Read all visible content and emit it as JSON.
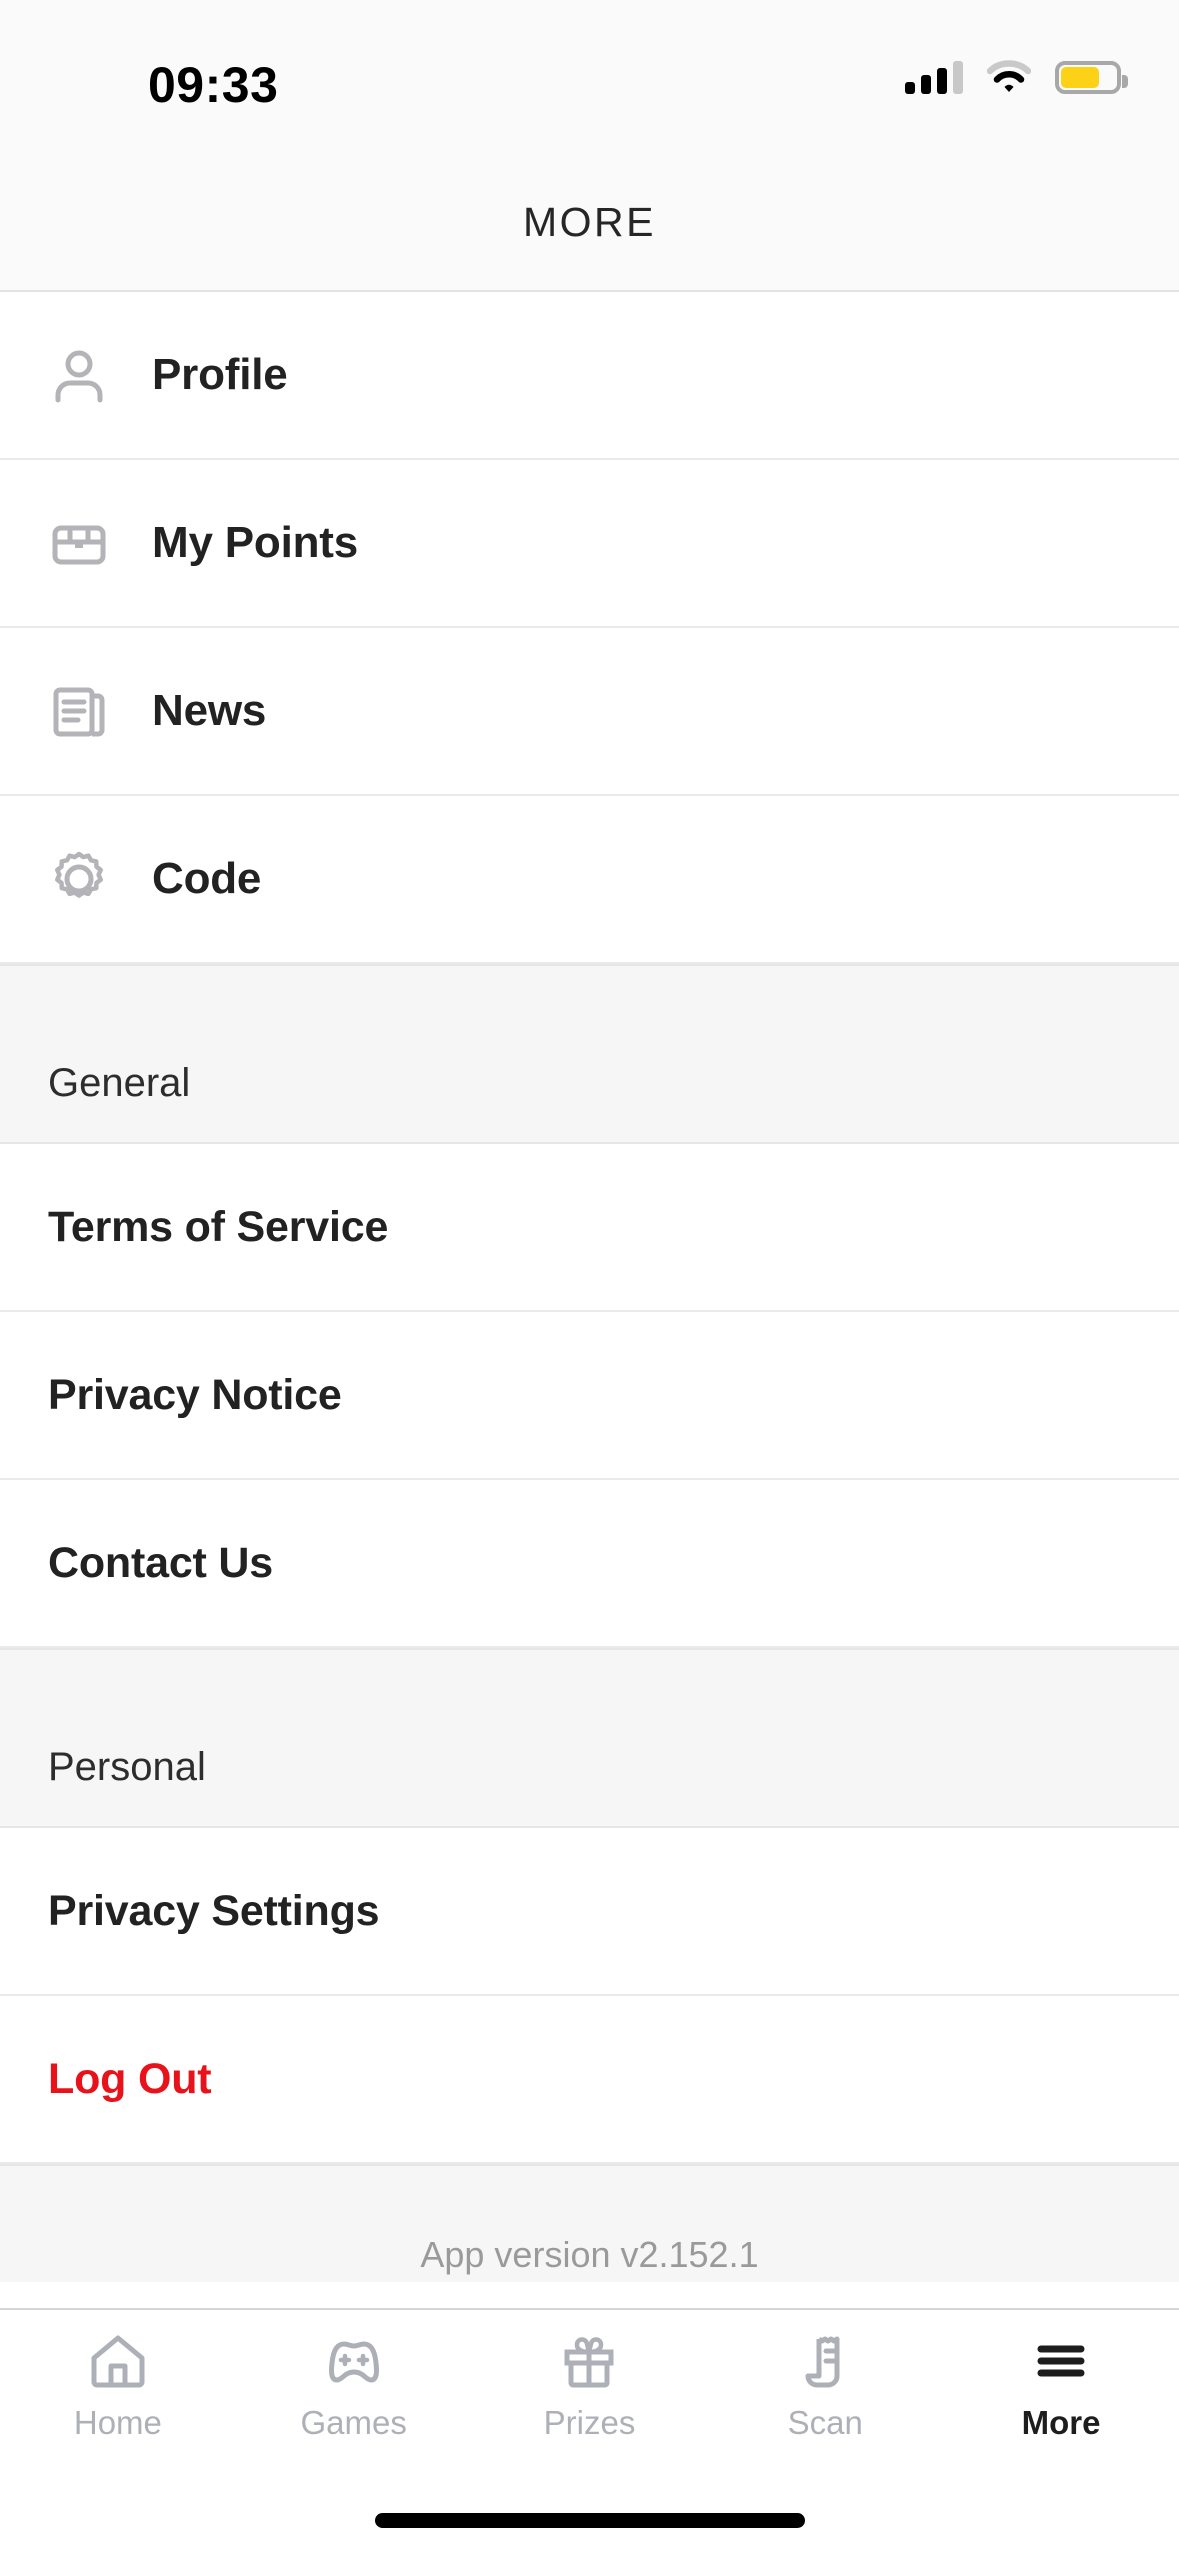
{
  "status_bar": {
    "time": "09:33",
    "signal_icon": "signal-bars-icon",
    "signal_bars_filled": 3,
    "signal_bars_total": 4,
    "wifi_icon": "wifi-icon",
    "battery_icon": "battery-icon",
    "battery_level_percent": 70,
    "battery_color": "#fcd116"
  },
  "header": {
    "title": "MORE"
  },
  "menu": {
    "primary_items": [
      {
        "label": "Profile",
        "icon": "person-icon"
      },
      {
        "label": "My Points",
        "icon": "treasure-chest-icon"
      },
      {
        "label": "News",
        "icon": "newspaper-icon"
      },
      {
        "label": "Code",
        "icon": "badge-seal-icon"
      }
    ],
    "sections": [
      {
        "title": "General",
        "items": [
          {
            "label": "Terms of Service",
            "color": "#222222"
          },
          {
            "label": "Privacy Notice",
            "color": "#222222"
          },
          {
            "label": "Contact Us",
            "color": "#222222"
          }
        ]
      },
      {
        "title": "Personal",
        "items": [
          {
            "label": "Privacy Settings",
            "color": "#222222"
          },
          {
            "label": "Log Out",
            "color": "#e8131a"
          }
        ]
      }
    ]
  },
  "footer": {
    "app_version": "App version v2.152.1"
  },
  "tab_bar": {
    "active_index": 4,
    "tabs": [
      {
        "label": "Home",
        "icon": "house-icon"
      },
      {
        "label": "Games",
        "icon": "gamepad-icon"
      },
      {
        "label": "Prizes",
        "icon": "gift-icon"
      },
      {
        "label": "Scan",
        "icon": "receipt-icon"
      },
      {
        "label": "More",
        "icon": "hamburger-menu-icon"
      }
    ]
  },
  "colors": {
    "accent_danger": "#e8131a",
    "text_primary": "#222222",
    "text_muted": "#9a9a9a",
    "icon_muted": "#b3b3b8",
    "section_bg": "#f6f6f6",
    "battery_yellow": "#fcd116"
  }
}
